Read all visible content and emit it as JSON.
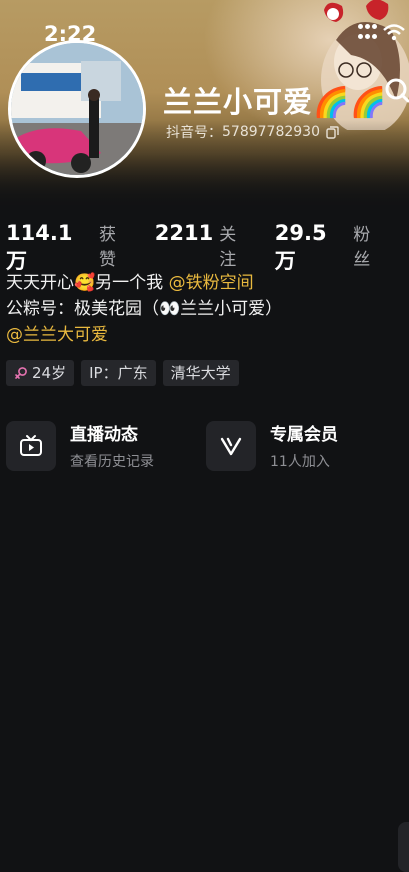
{
  "status_bar": {
    "time": "2:22"
  },
  "profile": {
    "name": "兰兰小可爱🌈🌈",
    "douyin_id_label": "抖音号：",
    "douyin_id": "57897782930"
  },
  "stats": [
    {
      "value": "114.1万",
      "label": "获赞"
    },
    {
      "value": "2211",
      "label": "关注"
    },
    {
      "value": "29.5万",
      "label": "粉丝"
    }
  ],
  "bio": {
    "line1_text": "天天开心🥰另一个我",
    "line1_link": "@铁粉空间",
    "line2": "公粽号：极美花园（👀兰兰小可爱）",
    "line3_link": "@兰兰大可爱"
  },
  "tags": [
    {
      "icon": "female-icon",
      "label": "24岁"
    },
    {
      "label": "IP：广东"
    },
    {
      "label": "清华大学"
    }
  ],
  "cards": [
    {
      "icon": "live-tv-icon",
      "title": "直播动态",
      "subtitle": "查看历史记录"
    },
    {
      "icon": "vip-v-icon",
      "title": "专属会员",
      "subtitle": "11人加入"
    }
  ],
  "colors": {
    "accent_link": "#e9b93f",
    "background": "#111214",
    "tag_bg": "#26272b"
  }
}
